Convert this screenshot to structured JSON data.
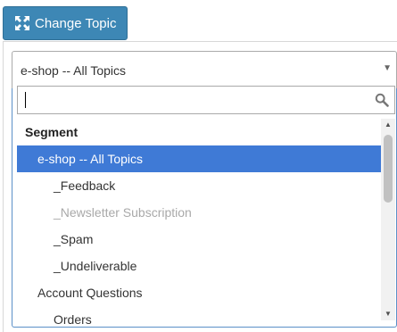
{
  "toolbar": {
    "change_topic_label": "Change Topic",
    "change_topic_icon": "expand-arrows-icon",
    "button_color": "#3d87b5"
  },
  "topic_select": {
    "selected_value": "e-shop -- All Topics",
    "search_value": "",
    "options": [
      {
        "label": "Segment",
        "type": "group"
      },
      {
        "label": "e-shop -- All Topics",
        "type": "option",
        "selected": true
      },
      {
        "label": "_Feedback",
        "type": "option"
      },
      {
        "label": "_Newsletter Subscription",
        "type": "option",
        "disabled": true
      },
      {
        "label": "_Spam",
        "type": "option"
      },
      {
        "label": "_Undeliverable",
        "type": "option"
      },
      {
        "label": "Account Questions",
        "type": "option"
      },
      {
        "label": "Orders",
        "type": "option"
      }
    ],
    "highlight_color": "#3f7ad6"
  }
}
